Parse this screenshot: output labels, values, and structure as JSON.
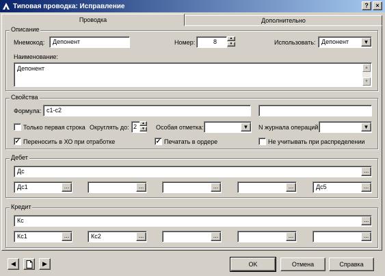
{
  "window": {
    "title": "Типовая проводка: Исправление",
    "help_btn": "?",
    "close_btn": "×"
  },
  "tabs": [
    {
      "label": "Проводка",
      "active": true
    },
    {
      "label": "Дополнительно",
      "active": false
    }
  ],
  "description": {
    "legend": "Описание",
    "mnemocode_label": "Мнемокод:",
    "mnemocode_value": "Депонент",
    "number_label": "Номер:",
    "number_value": "8",
    "use_label": "Использовать:",
    "use_value": "Депонент",
    "name_label": "Наименование:",
    "name_value": "Депонент"
  },
  "properties": {
    "legend": "Свойства",
    "formula_label": "Формула:",
    "formula_value": "с1-с2",
    "formula_extra_value": "",
    "first_line_only_label": "Только первая строка",
    "first_line_only_checked": false,
    "round_label": "Округлять до:",
    "round_value": "2",
    "special_mark_label": "Особая отметка:",
    "special_mark_value": "",
    "journal_label": "N журнала операций:",
    "journal_value": "",
    "transfer_label": "Переносить в ХО при отработке",
    "transfer_checked": true,
    "print_label": "Печатать в ордере",
    "print_checked": true,
    "ignore_label": "Не учитывать при распределении",
    "ignore_checked": false
  },
  "debit": {
    "legend": "Дебет",
    "account": "Дс",
    "fields": [
      "Дс1",
      "",
      "",
      "",
      "Дс5"
    ]
  },
  "credit": {
    "legend": "Кредит",
    "account": "Кс",
    "fields": [
      "Кс1",
      "Кс2",
      "",
      "",
      ""
    ]
  },
  "footer": {
    "ok_label": "OK",
    "cancel_label": "Отмена",
    "help_label": "Справка",
    "ellipsis": "...",
    "check_mark": "✓",
    "prev_glyph": "◀",
    "next_glyph": "▶"
  }
}
